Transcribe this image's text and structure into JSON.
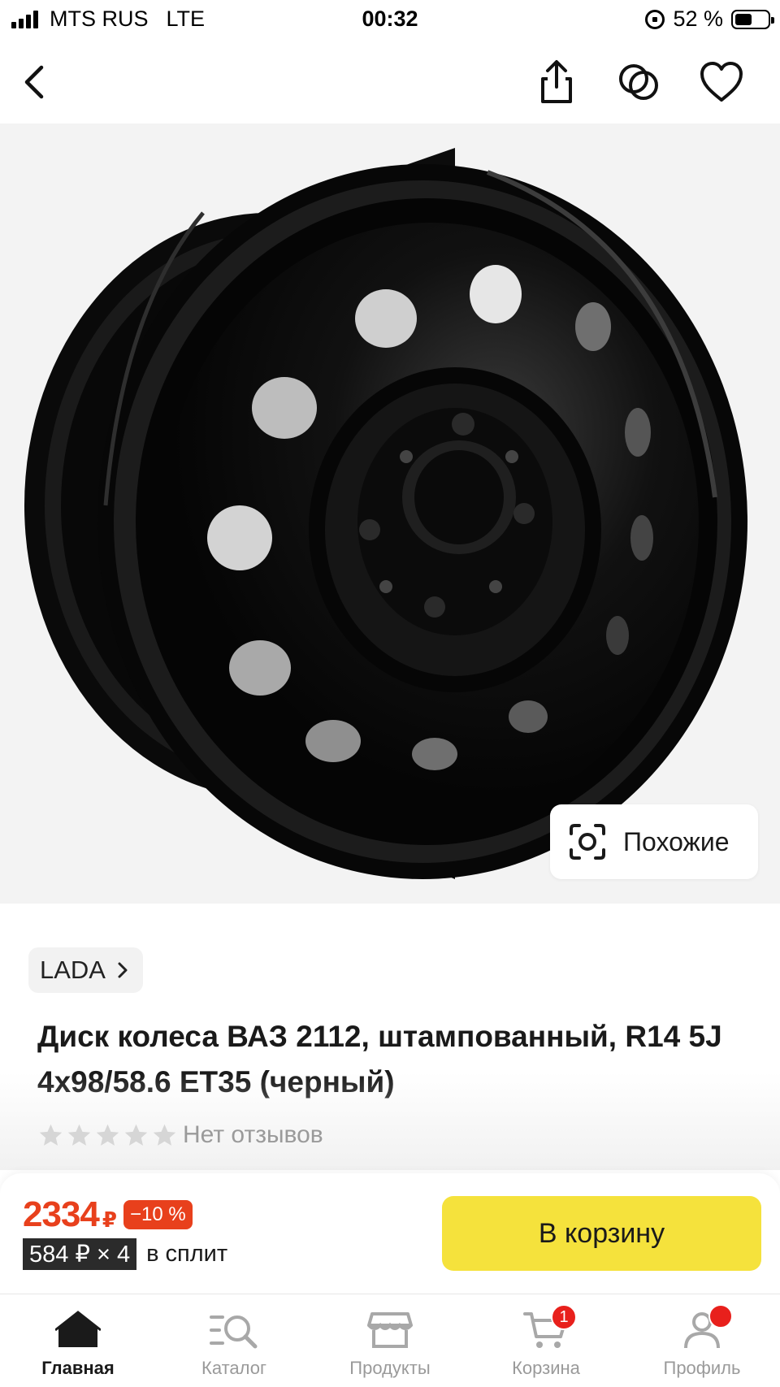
{
  "status_bar": {
    "carrier": "MTS RUS",
    "network": "LTE",
    "time": "00:32",
    "battery": "52 %",
    "battery_level": 0.52
  },
  "nav": {
    "back_icon": "chevron-left-icon",
    "share_icon": "share-icon",
    "compare_icon": "compare-icon",
    "favorite_icon": "heart-icon"
  },
  "hero": {
    "similar_label": "Похожие",
    "similar_icon": "camera-scan-icon"
  },
  "product": {
    "brand": "LADA",
    "title": "Диск колеса ВАЗ 2112, штампованный, R14 5J 4x98/58.6 ET35 (черный)",
    "rating_stars": 0,
    "rating_text": "Нет отзывов"
  },
  "buy": {
    "price": "2334",
    "currency": "₽",
    "discount": "−10 %",
    "split_amount": "584 ₽ × 4",
    "split_text": "в сплит",
    "cart_button": "В корзину",
    "accent_color": "#e8401c",
    "button_color": "#f5e23c"
  },
  "tabbar": {
    "tabs": [
      {
        "label": "Главная",
        "icon": "home-icon",
        "active": true
      },
      {
        "label": "Каталог",
        "icon": "catalog-search-icon",
        "active": false
      },
      {
        "label": "Продукты",
        "icon": "store-icon",
        "active": false
      },
      {
        "label": "Корзина",
        "icon": "cart-icon",
        "active": false,
        "badge": "1"
      },
      {
        "label": "Профиль",
        "icon": "profile-icon",
        "active": false
      }
    ]
  }
}
